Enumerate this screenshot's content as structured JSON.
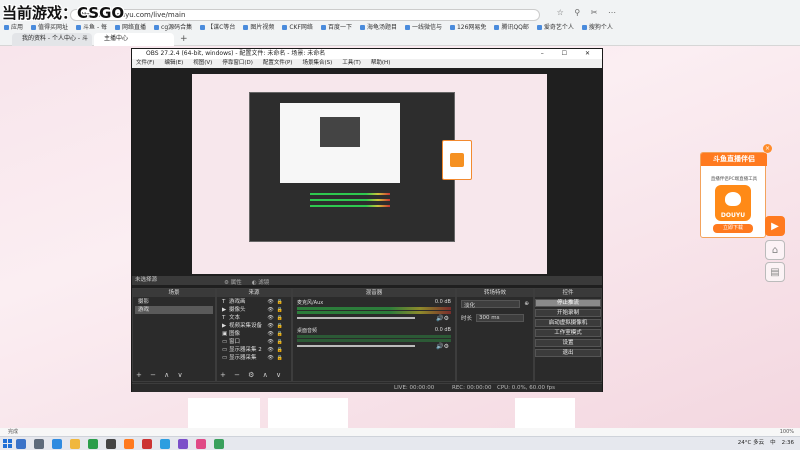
{
  "overlay": {
    "title": "当前游戏：CSGO"
  },
  "browser": {
    "url": "http://mp.douyu.com/live/main",
    "bookmarks": [
      "应用",
      "值得买网址",
      "斗鱼 - 每",
      "网络直播",
      "cg源码合集",
      "【谋C等台",
      "图片视频",
      "CKF网络",
      "百度一下",
      "海龟汤题目",
      "一线微信与",
      "126网易免",
      "腾讯QQ邮",
      "爱奇艺个人",
      "搜狗个人"
    ],
    "tabs": [
      {
        "label": "我的资料 - 个人中心 - 斗"
      },
      {
        "label": "主播中心"
      }
    ],
    "status": "完成",
    "zoom": "100%"
  },
  "obs": {
    "title": "OBS 27.2.4 (64-bit, windows) - 配置文件: 未命名 - 场景: 未命名",
    "menu": [
      "文件(F)",
      "编辑(E)",
      "视图(V)",
      "停靠窗口(D)",
      "配置文件(P)",
      "场景集合(S)",
      "工具(T)",
      "帮助(H)"
    ],
    "scene_label": "未选择源",
    "toolbar": [
      "属性",
      "滤镜"
    ],
    "docks": {
      "scenes": {
        "title": "场景",
        "items": [
          "摄影",
          "游戏"
        ]
      },
      "sources": {
        "title": "来源",
        "items": [
          "游戏画",
          "摄像头",
          "文本",
          "视频采集设备",
          "图像",
          "窗口",
          "显示器采集 2",
          "显示器采集"
        ]
      },
      "mixer": {
        "title": "混音器",
        "items": [
          {
            "name": "麦克风/Aux",
            "db": "0.0 dB"
          },
          {
            "name": "桌面音频",
            "db": "0.0 dB"
          }
        ]
      },
      "transitions": {
        "title": "转场特效",
        "type": "淡化",
        "duration_label": "时长",
        "duration": "300 ms"
      },
      "controls": {
        "title": "控件",
        "buttons": [
          "停止推流",
          "开始录制",
          "启动虚拟摄像机",
          "工作室模式",
          "设置",
          "退出"
        ]
      }
    },
    "status": {
      "live": "LIVE: 00:00:00",
      "rec": "REC: 00:00:00",
      "cpu": "CPU: 0.0%, 60.00 fps"
    }
  },
  "ad": {
    "title": "斗鱼直播伴侣",
    "subtitle": "直播伴侣PC端直播工具",
    "logo_text": "DOUYU",
    "button": "立即下载"
  },
  "taskbar": {
    "weather": "24°C 多云",
    "ime": "中",
    "time": "2:36"
  },
  "colors": {
    "accent": "#ff7a1f",
    "obs_bg": "#2b2b2b",
    "page_bg": "#f7e3ea"
  }
}
